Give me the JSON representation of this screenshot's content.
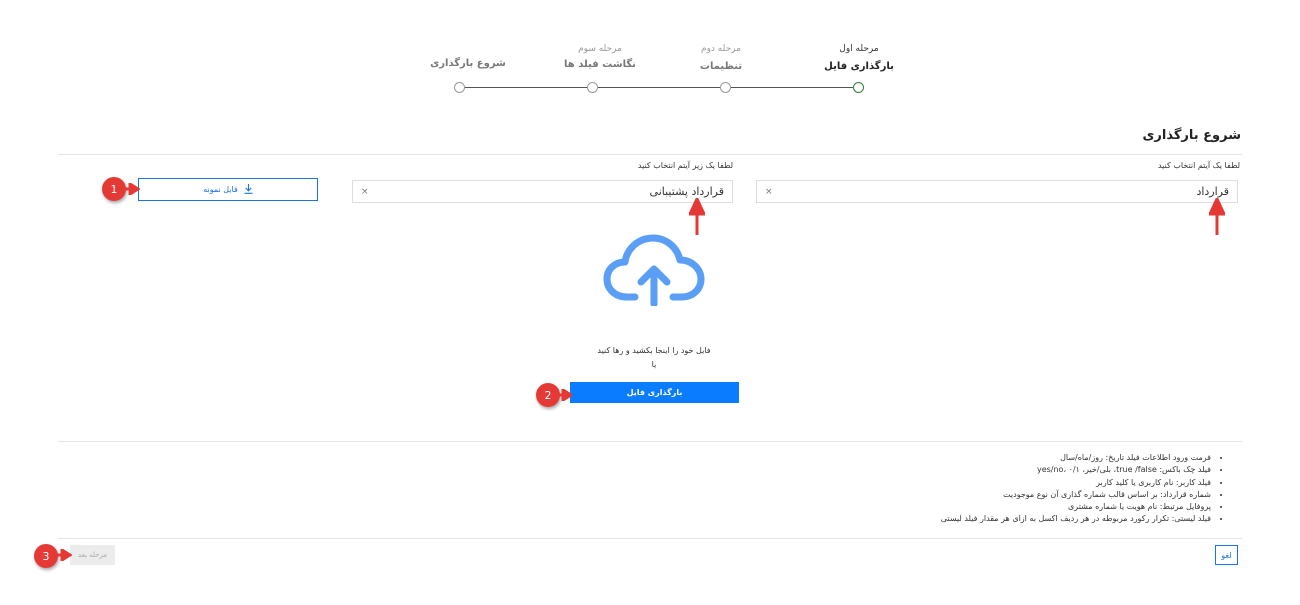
{
  "stepper": {
    "steps": [
      {
        "small": "مرحله اول",
        "main": "بارگذاری فایل"
      },
      {
        "small": "مرحله دوم",
        "main": "تنظیمات"
      },
      {
        "small": "مرحله سوم",
        "main": "نگاشت فیلد ها"
      },
      {
        "small": "",
        "main": "شروع بارگذاری"
      }
    ],
    "active_step": 1,
    "active_color": "#2e7d32"
  },
  "section": {
    "title": "شروع بارگذاری"
  },
  "item_select": {
    "label": "لطفا یک آیتم انتخاب کنید",
    "value": "قرارداد",
    "clear": "×"
  },
  "subitem_select": {
    "label": "لطفا یک زیر آیتم انتخاب کنید",
    "value": "قرارداد پشتیبانی",
    "clear": "×"
  },
  "sample_file_button": {
    "label": "فایل نمونه",
    "icon": "download-icon"
  },
  "upload": {
    "icon": "cloud-upload-icon",
    "drag_text": "فایل خود را اینجا بکشید و رها کنید",
    "or_text": "یا",
    "button_label": "بارگذاری فایل",
    "accent": "#0a7cff"
  },
  "notes": [
    "فرمت ورود اطلاعات فیلد تاریخ: روز/ماه/سال",
    "فیلد چک باکس: true /false، بلی/خیر، yes/no، ۰/۱",
    "فیلد کاربر: نام کاربری یا کلید کاربر",
    "شماره قرارداد: بر اساس قالب شماره گذاری آن نوع موجودیت",
    "پروفایل مرتبط: نام هویت یا شماره مشتری",
    "فیلد لیستی: تکرار رکورد مربوطه در هر ردیف اکسل به ازای هر مقدار فیلد لیستی"
  ],
  "footer": {
    "next_label": "مرحله بعد",
    "cancel_label": "لغو"
  },
  "annotations": {
    "badge1": "1",
    "badge2": "2",
    "badge3": "3",
    "color": "#e53935"
  }
}
